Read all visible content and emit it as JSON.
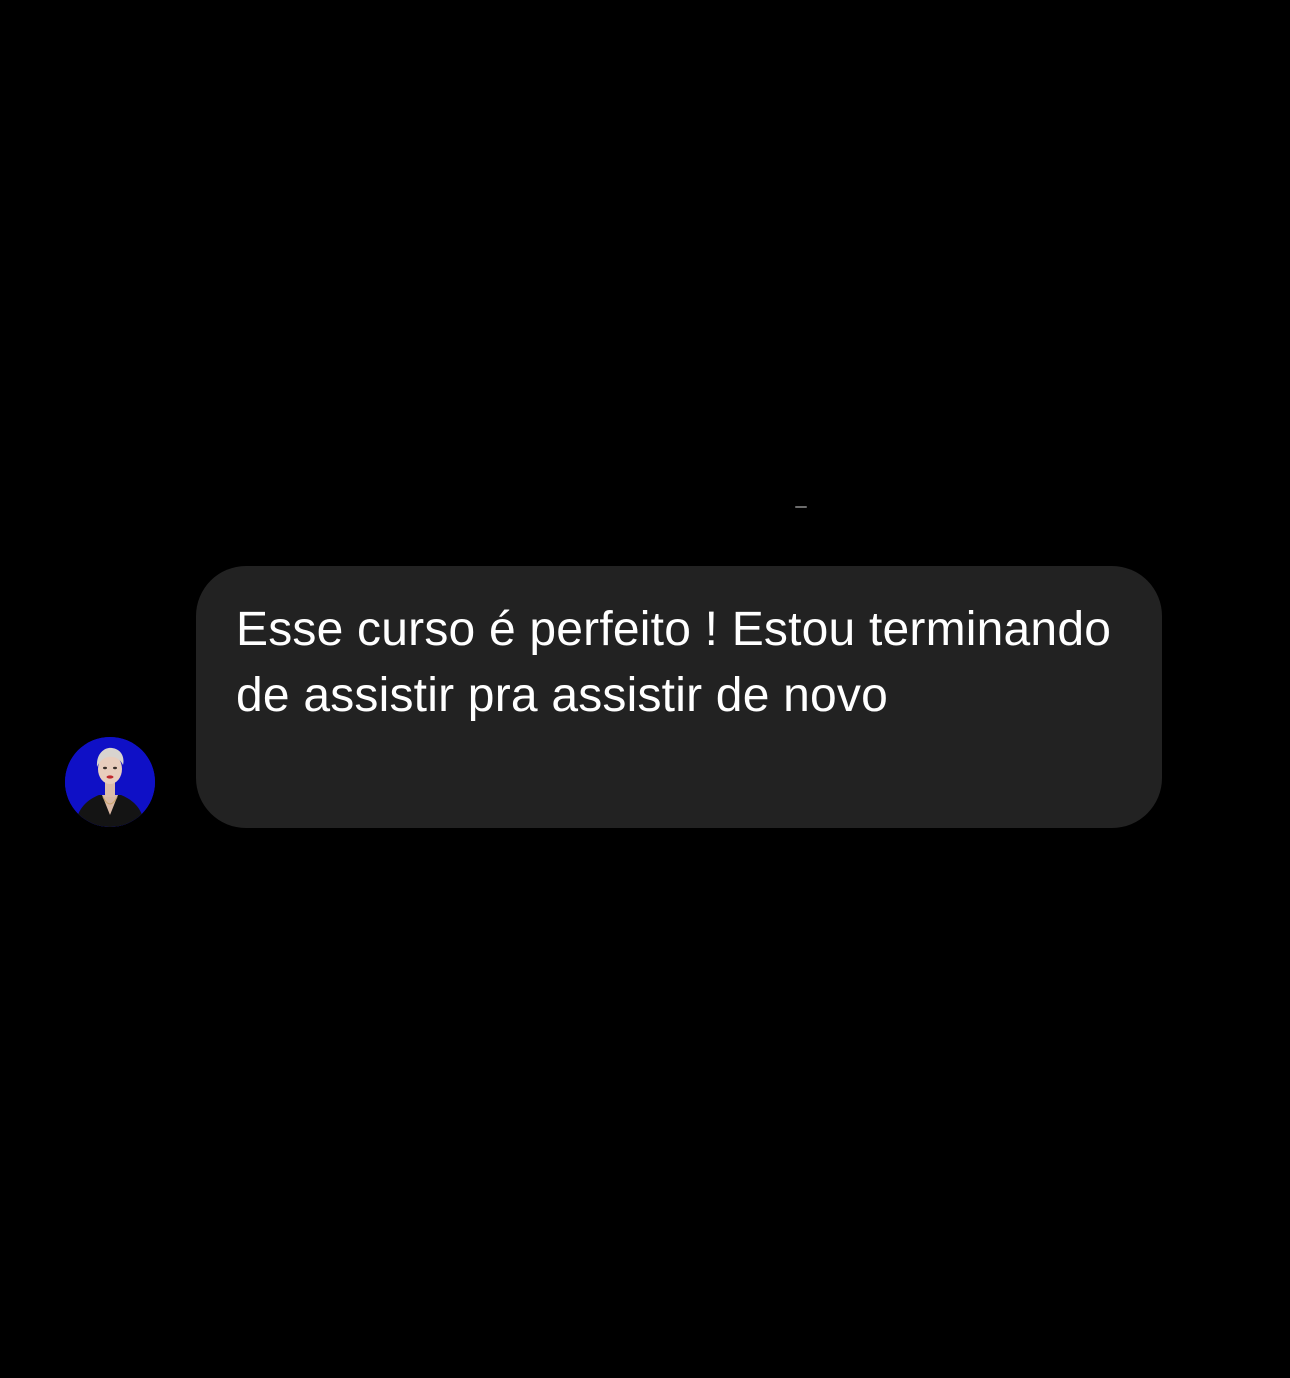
{
  "conversation": {
    "message": {
      "text": "Esse curso é perfeito ! Estou terminando de assistir pra assistir de novo",
      "bubble_color": "#222222",
      "text_color": "#ffffff"
    },
    "avatar": {
      "icon": "user-avatar-photo",
      "background_color": "#1010c8"
    },
    "background_color": "#000000"
  }
}
